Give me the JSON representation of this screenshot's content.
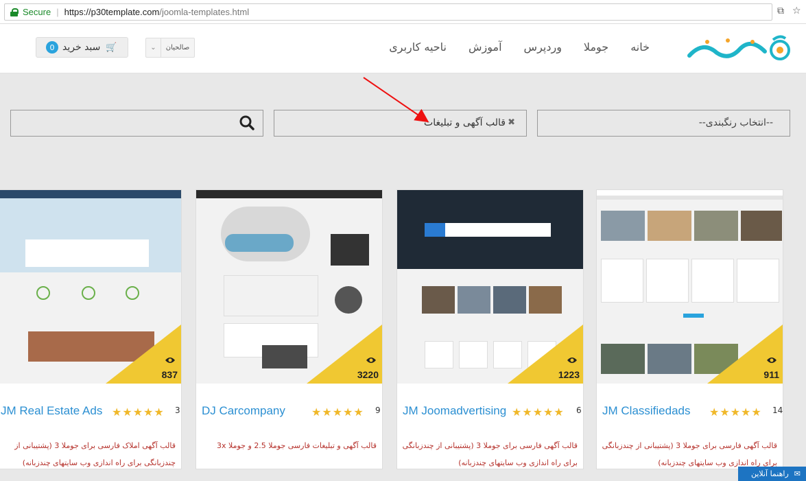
{
  "browser": {
    "secure_label": "Secure",
    "url_host": "https://p30template.com",
    "url_path": "/joomla-templates.html"
  },
  "header": {
    "nav": [
      "خانه",
      "جوملا",
      "وردپرس",
      "آموزش",
      "ناحیه کاربری"
    ],
    "user_name": "صالحیان",
    "cart_label": "سبد خرید",
    "cart_count": "0"
  },
  "filters": {
    "category_placeholder": "--انتخاب رنگبندی--",
    "active_tag": "قالب آگهی و تبلیغات"
  },
  "cards": [
    {
      "title": "JM Classifiedads",
      "views": "911",
      "rating_count": "14",
      "stars": "★★★★★",
      "description": "قالب آگهی فارسی برای جوملا 3 (پشتیبانی از چندزبانگی برای راه اندازی وب سایتهای چندزبانه)"
    },
    {
      "title": "JM Joomadvertising",
      "views": "1223",
      "rating_count": "6",
      "stars": "★★★★★",
      "description": "قالب آگهی فارسی برای جوملا 3 (پشتیبانی از چندزبانگی برای راه اندازی وب سایتهای چندزبانه)"
    },
    {
      "title": "DJ Carcompany",
      "views": "3220",
      "rating_count": "9",
      "stars": "★★★★★",
      "description": "قالب آگهی و تبلیغات فارسی جوملا 2.5 و جوملا 3x"
    },
    {
      "title": "JM Real Estate Ads",
      "views": "837",
      "rating_count": "3",
      "stars": "★★★★★",
      "description": "قالب آگهی املاک فارسی برای جوملا 3 (پشتیبانی از چندزبانگی برای راه اندازی وب سایتهای چندزبانه)"
    }
  ],
  "chat": {
    "label": "راهنما آنلاین"
  },
  "colors": {
    "accent": "#2b8fd2",
    "corner": "#f0c832",
    "desc": "#b5302a"
  }
}
